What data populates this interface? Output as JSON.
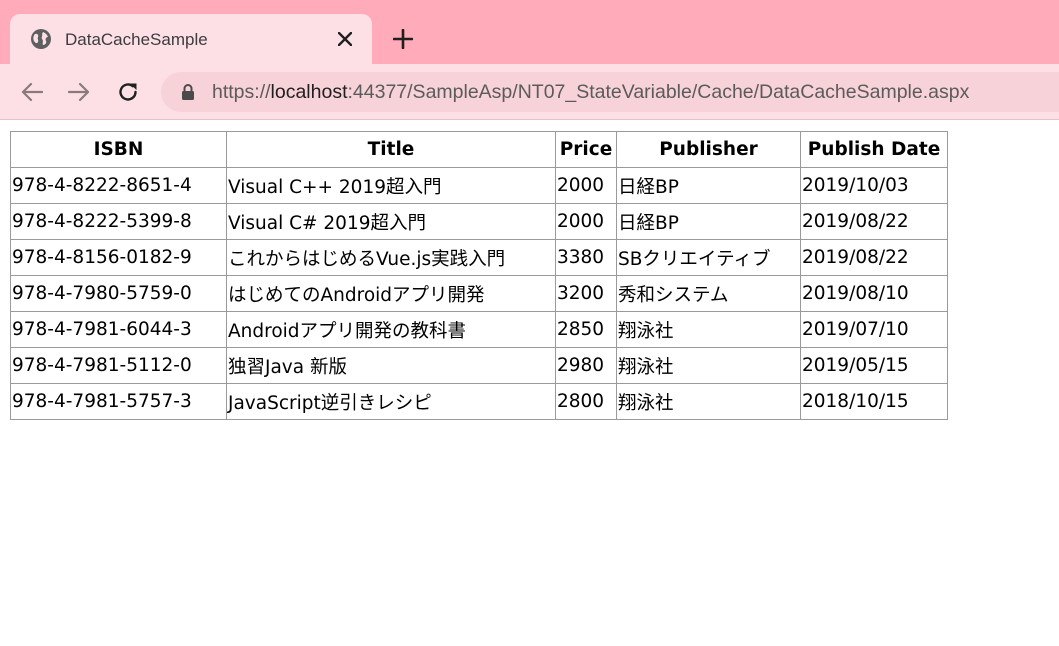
{
  "browser": {
    "tab_title": "DataCacheSample",
    "url_scheme": "https://",
    "url_host": "localhost",
    "url_rest": ":44377/SampleAsp/NT07_StateVariable/Cache/DataCacheSample.aspx"
  },
  "icons": {
    "favicon": "globe-icon",
    "close": "close-icon",
    "new_tab": "plus-icon",
    "back": "back-arrow-icon",
    "forward": "forward-arrow-icon",
    "reload": "reload-icon",
    "lock": "lock-icon"
  },
  "colors": {
    "chrome_background": "#ffabb9",
    "tab_background": "#fde0e5",
    "omnibox_background": "#f7d2d8"
  },
  "table": {
    "headers": [
      "ISBN",
      "Title",
      "Price",
      "Publisher",
      "Publish Date"
    ],
    "rows": [
      [
        "978-4-8222-8651-4",
        "Visual C++ 2019超入門",
        "2000",
        "日経BP",
        "2019/10/03"
      ],
      [
        "978-4-8222-5399-8",
        "Visual C# 2019超入門",
        "2000",
        "日経BP",
        "2019/08/22"
      ],
      [
        "978-4-8156-0182-9",
        "これからはじめるVue.js実践入門",
        "3380",
        "SBクリエイティブ",
        "2019/08/22"
      ],
      [
        "978-4-7980-5759-0",
        "はじめてのAndroidアプリ開発",
        "3200",
        "秀和システム",
        "2019/08/10"
      ],
      [
        "978-4-7981-6044-3",
        "Androidアプリ開発の教科書",
        "2850",
        "翔泳社",
        "2019/07/10"
      ],
      [
        "978-4-7981-5112-0",
        "独習Java 新版",
        "2980",
        "翔泳社",
        "2019/05/15"
      ],
      [
        "978-4-7981-5757-3",
        "JavaScript逆引きレシピ",
        "2800",
        "翔泳社",
        "2018/10/15"
      ]
    ]
  }
}
